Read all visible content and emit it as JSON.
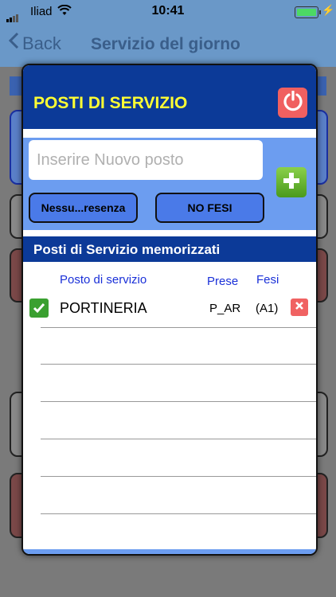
{
  "status_bar": {
    "carrier": "Iliad",
    "time": "10:41"
  },
  "nav": {
    "back_label": "Back",
    "title": "Servizio del giorno"
  },
  "modal": {
    "title": "POSTI DI SERVIZIO",
    "new_post_placeholder": "Inserire Nuovo posto",
    "presence_button": "Nessu...resenza",
    "no_fesi_button": "NO FESI",
    "section_title": "Posti di Servizio memorizzati",
    "columns": {
      "post": "Posto di servizio",
      "prese": "Prese",
      "fesi": "Fesi"
    },
    "rows": [
      {
        "name": "PORTINERIA",
        "prese": "P_AR",
        "fesi": "(A1)",
        "checked": true
      }
    ]
  },
  "colors": {
    "header": "#0c3a98",
    "title": "#ffff33",
    "form_bg": "#6c9df0",
    "button": "#4a7ae8",
    "column_text": "#1a30d8"
  }
}
